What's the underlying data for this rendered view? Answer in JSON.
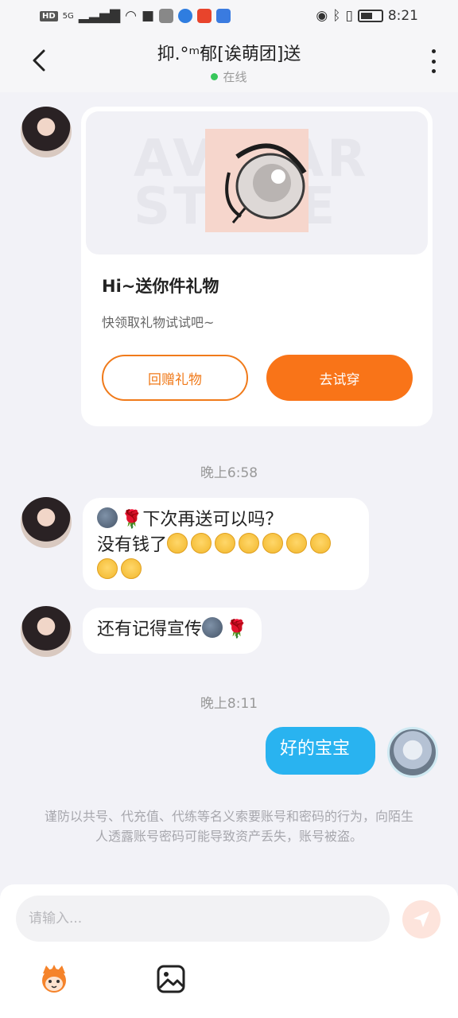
{
  "status_bar": {
    "left_label": "HD",
    "signal": "5G",
    "time": "8:21"
  },
  "header": {
    "title": "抑.°ᵐ郁[诶萌团]送",
    "status": "在线"
  },
  "gift_card": {
    "watermark": "AVATAR STORE",
    "title": "Hi~送你件礼物",
    "subtitle": "快领取礼物试试吧~",
    "return_gift_label": "回赠礼物",
    "try_on_label": "去试穿"
  },
  "messages": [
    {
      "timestamp": "晚上6:58"
    },
    {
      "text_line1": "下次再送可以吗？",
      "text_line2": "没有钱了"
    },
    {
      "text": "还有记得宣传"
    },
    {
      "timestamp": "晚上8:11"
    },
    {
      "text": "好的宝宝"
    }
  ],
  "warning": "谨防以共号、代充值、代练等名义索要账号和密码的行为，向陌生人透露账号密码可能导致资产丢失，账号被盗。",
  "input": {
    "placeholder": "请输入..."
  },
  "colors": {
    "accent": "#f97418",
    "self_bubble": "#29b3f0",
    "online": "#37c75a"
  }
}
